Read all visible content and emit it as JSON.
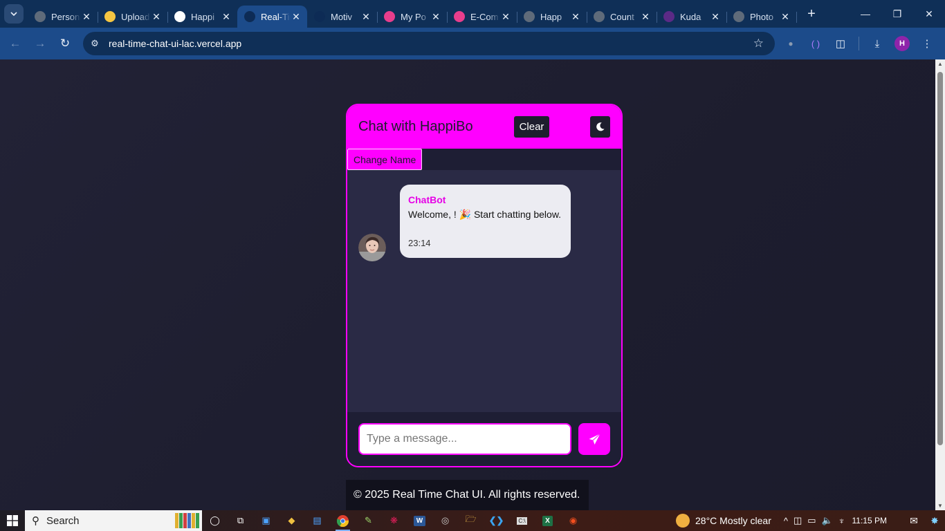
{
  "browser": {
    "tabs": [
      {
        "title": "Personal",
        "favicon_color": "#5f6b7a",
        "active": false
      },
      {
        "title": "Upload",
        "favicon_color": "#f5c542",
        "active": false
      },
      {
        "title": "Happi",
        "favicon_color": "#ffffff",
        "active": false
      },
      {
        "title": "Real-Time",
        "favicon_color": "#0d2b55",
        "active": true
      },
      {
        "title": "Motiv",
        "favicon_color": "#0d2b55",
        "active": false
      },
      {
        "title": "My Po",
        "favicon_color": "#e83e8c",
        "active": false
      },
      {
        "title": "E-Com",
        "favicon_color": "#e83e8c",
        "active": false
      },
      {
        "title": "Happ",
        "favicon_color": "#5f6b7a",
        "active": false
      },
      {
        "title": "Count",
        "favicon_color": "#5f6b7a",
        "active": false
      },
      {
        "title": "Kuda",
        "favicon_color": "#5b2a86",
        "active": false
      },
      {
        "title": "Photo",
        "favicon_color": "#5f6b7a",
        "active": false
      }
    ],
    "url": "real-time-chat-ui-lac.vercel.app",
    "profile_initial": "H"
  },
  "chat": {
    "title": "Chat with HappiBo",
    "clear_label": "Clear",
    "change_name_label": "Change Name",
    "message": {
      "sender": "ChatBot",
      "text": "Welcome, ! 🎉 Start chatting below.",
      "time": "23:14"
    },
    "input_placeholder": "Type a message..."
  },
  "footer": {
    "text": "© 2025 Real Time Chat UI. All rights reserved."
  },
  "taskbar": {
    "search_label": "Search",
    "weather": "28°C  Mostly clear",
    "time": "11:15 PM"
  }
}
